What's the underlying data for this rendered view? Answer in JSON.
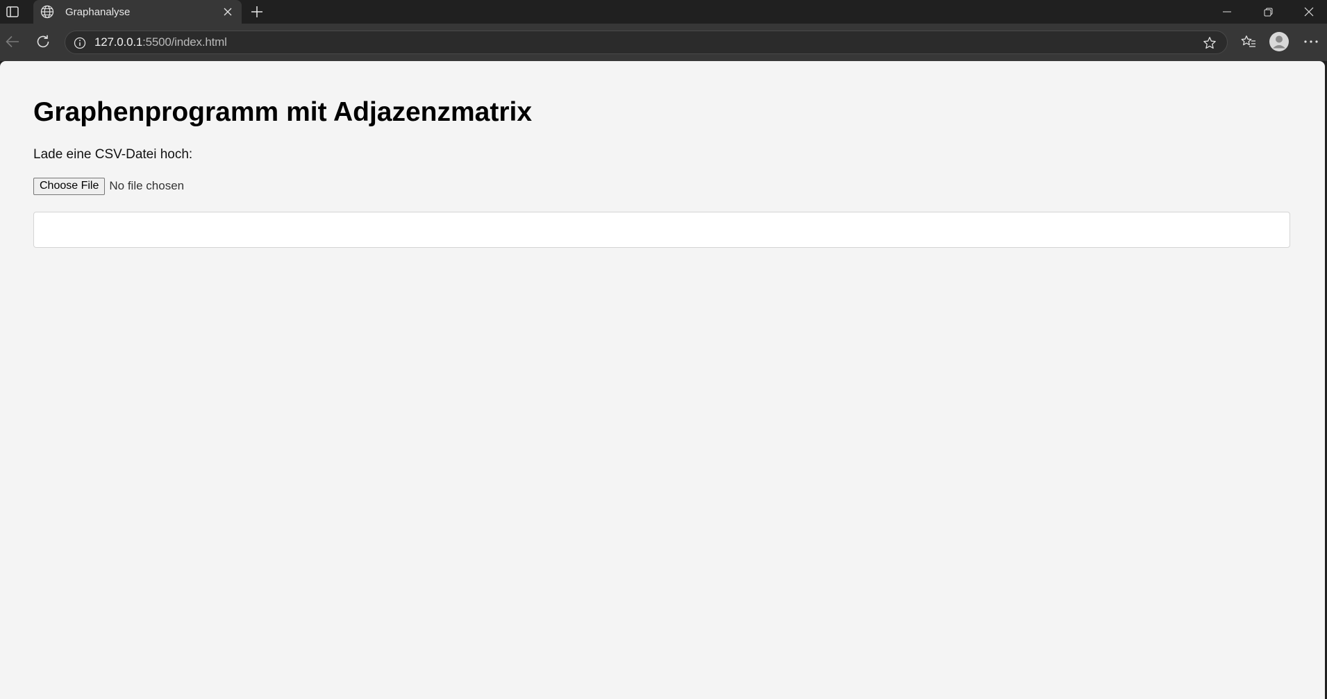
{
  "browser": {
    "tab": {
      "title": "Graphanalyse",
      "icon": "globe-icon"
    },
    "address": {
      "host": "127.0.0.1",
      "rest": ":5500/index.html"
    },
    "icons": {
      "tab_actions": "tab-actions-icon",
      "close_tab": "close-icon",
      "new_tab": "plus-icon",
      "minimize": "minimize-icon",
      "maximize": "restore-icon",
      "close_window": "close-icon",
      "back": "back-arrow-icon",
      "reload": "reload-icon",
      "site_info": "info-icon",
      "favorite": "star-icon",
      "favorites": "favorites-icon",
      "profile": "avatar-icon",
      "more": "more-icon"
    },
    "colors": {
      "chrome_dark": "#202020",
      "chrome_tab": "#373737",
      "page_bg": "#f4f4f4"
    }
  },
  "page": {
    "title": "Graphenprogramm mit Adjazenzmatrix",
    "upload_label": "Lade eine CSV-Datei hoch:",
    "file_input": {
      "button_label": "Choose File",
      "status": "No file chosen"
    },
    "output": ""
  }
}
